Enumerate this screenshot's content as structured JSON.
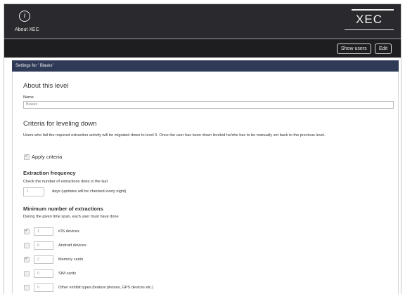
{
  "header": {
    "about_label": "About XEC",
    "logo_text": "XEC"
  },
  "toolbar": {
    "show_users_label": "Show users",
    "edit_label": "Edit"
  },
  "panel": {
    "title": "Settings for ' Blaskx '"
  },
  "about_section": {
    "heading": "About this level",
    "name_label": "Name",
    "name_value": "Blaskx"
  },
  "criteria_section": {
    "heading": "Criteria for leveling down",
    "description": "Users who fail the required extraction activity will be migrated down to level 0. Once the user has been down leveled he/she has to be manually set back to the previous level.",
    "apply_label": "Apply criteria",
    "apply_checked": true
  },
  "frequency_section": {
    "heading": "Extraction frequency",
    "description": "Check the number of extractions done in the last",
    "days_value": "1",
    "days_suffix": "days (updates will be checked every night)"
  },
  "minimum_section": {
    "heading": "Minimum number of extractions",
    "description": "During the given time span, each user must have done",
    "devices": [
      {
        "label": "iOS devices",
        "value": "1",
        "checked": true
      },
      {
        "label": "Android devices",
        "value": "0",
        "checked": false
      },
      {
        "label": "Memory cards",
        "value": "2",
        "checked": true
      },
      {
        "label": "SIM cards",
        "value": "0",
        "checked": false
      },
      {
        "label": "Other exhibit types (feature phones, GPS devices etc.)",
        "value": "0",
        "checked": false
      }
    ]
  },
  "colors": {
    "topbar": "#2a2a2e",
    "toolbar": "#1e1e20",
    "panel_header": "#2f3a57"
  },
  "icons": {
    "about": "info-icon",
    "check": "checkmark-icon"
  }
}
